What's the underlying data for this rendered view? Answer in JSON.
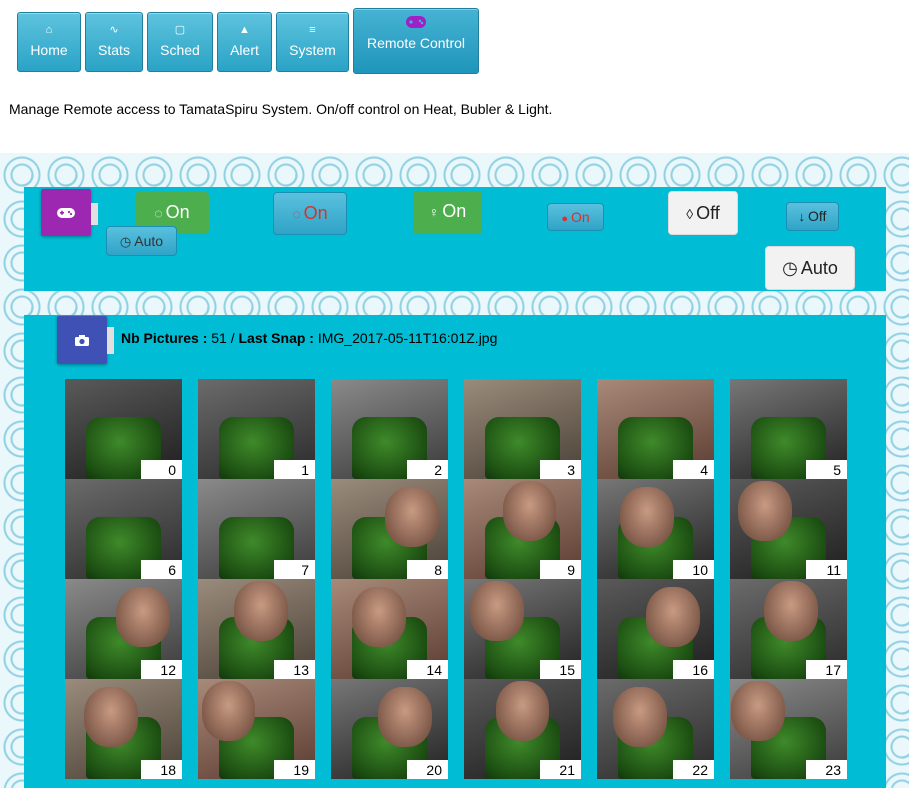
{
  "nav": [
    {
      "label": "Home",
      "icon": "home-icon",
      "glyph": "⌂"
    },
    {
      "label": "Stats",
      "icon": "pulse-icon",
      "glyph": "∿"
    },
    {
      "label": "Sched",
      "icon": "calendar-icon",
      "glyph": "▢"
    },
    {
      "label": "Alert",
      "icon": "warning-icon",
      "glyph": "▲"
    },
    {
      "label": "System",
      "icon": "sliders-icon",
      "glyph": "≡"
    },
    {
      "label": "Remote Control",
      "icon": "gamepad-icon",
      "glyph": "🎮"
    }
  ],
  "intro_text": "Manage Remote access to TamataSpiru System. On/off control on Heat, Bubler & Light.",
  "controls": {
    "bubbler_state": "On",
    "heat_state": "On",
    "light_state": "On",
    "mode_auto_small": "Auto",
    "heat_indicator": "On",
    "water_state": "Off",
    "level_state": "Off",
    "mode_auto_large": "Auto"
  },
  "gallery": {
    "count_label": "Nb Pictures :",
    "count": "51",
    "separator": "/",
    "last_label": "Last Snap :",
    "last_snap": "IMG_2017-05-11T16:01Z.jpg",
    "thumbs": [
      "0",
      "1",
      "2",
      "3",
      "4",
      "5",
      "6",
      "7",
      "8",
      "9",
      "10",
      "11",
      "12",
      "13",
      "14",
      "15",
      "16",
      "17",
      "18",
      "19",
      "20",
      "21",
      "22",
      "23"
    ]
  },
  "colors": {
    "panel": "#00bcd4",
    "gamepad_card": "#9c27b0",
    "camera_card": "#3f51b5",
    "green": "#4cae4c",
    "red": "#d9312b"
  }
}
